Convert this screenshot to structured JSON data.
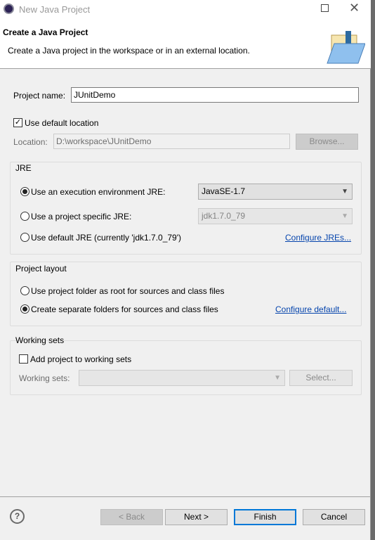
{
  "window": {
    "title": "New Java Project"
  },
  "banner": {
    "title": "Create a Java Project",
    "description": "Create a Java project in the workspace or in an external location."
  },
  "project_name": {
    "label": "Project name:",
    "value": "JUnitDemo"
  },
  "default_location": {
    "label": "Use default location",
    "checked": true
  },
  "location": {
    "label": "Location:",
    "value": "D:\\workspace\\JUnitDemo",
    "browse": "Browse..."
  },
  "jre": {
    "title": "JRE",
    "options": [
      {
        "label": "Use an execution environment JRE:",
        "selected": true,
        "combo": "JavaSE-1.7"
      },
      {
        "label": "Use a project specific JRE:",
        "selected": false,
        "combo": "jdk1.7.0_79"
      },
      {
        "label": "Use default JRE (currently 'jdk1.7.0_79')",
        "selected": false
      }
    ],
    "configure": "Configure JREs..."
  },
  "layout": {
    "title": "Project layout",
    "options": [
      {
        "label": "Use project folder as root for sources and class files",
        "selected": false
      },
      {
        "label": "Create separate folders for sources and class files",
        "selected": true
      }
    ],
    "configure": "Configure default..."
  },
  "working_sets": {
    "title": "Working sets",
    "add_label": "Add project to working sets",
    "checked": false,
    "label": "Working sets:",
    "value": "",
    "select": "Select..."
  },
  "footer": {
    "back": "< Back",
    "next": "Next >",
    "finish": "Finish",
    "cancel": "Cancel"
  }
}
